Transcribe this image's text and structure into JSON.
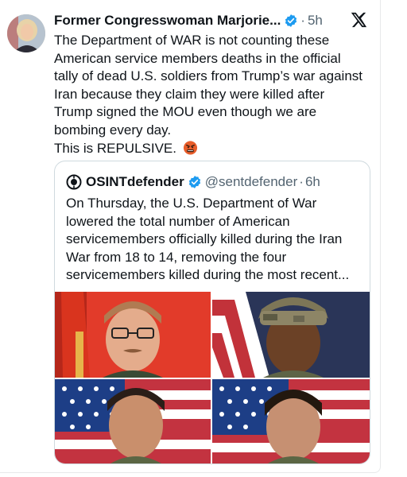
{
  "tweet": {
    "author_name": "Former Congresswoman Marjorie...",
    "time": "5h",
    "text": "The Department of WAR is not counting these American service members deaths in the official tally of dead U.S. soldiers from Trump’s war against Iran because they claim they were killed after Trump signed the MOU even though we are bombing every day.",
    "text_last_line": "This is REPULSIVE.",
    "emoji": "angry-face-emoji"
  },
  "quote": {
    "author_name": "OSINTdefender",
    "handle": "@sentdefender",
    "time": "6h",
    "text": "On Thursday, the U.S. Department of War lowered the total number of American servicemembers officially killed during the Iran War from 18 to 14, removing the four servicemembers killed during the most recent...",
    "media_alt": "four-servicemember-portraits"
  },
  "colors": {
    "verified": "#1d9bf0",
    "text": "#0f1419",
    "muted": "#536471",
    "border": "#cfd9de"
  }
}
